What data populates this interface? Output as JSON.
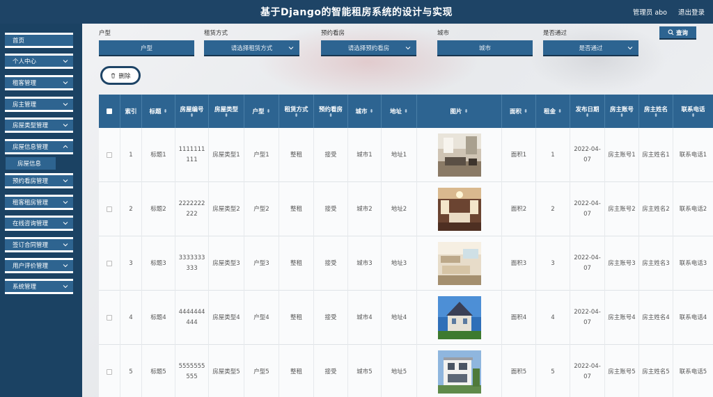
{
  "header": {
    "title": "基于Django的智能租房系统的设计与实现",
    "user": "管理员 abo",
    "logout": "退出登录"
  },
  "sidebar": {
    "items": [
      {
        "label": "首页",
        "has_chevron": false
      },
      {
        "label": "个人中心",
        "has_chevron": true
      },
      {
        "label": "租客管理",
        "has_chevron": true
      },
      {
        "label": "房主管理",
        "has_chevron": true
      },
      {
        "label": "房屋类型管理",
        "has_chevron": true
      },
      {
        "label": "房屋信息管理",
        "has_chevron": true
      },
      {
        "label": "预约看房管理",
        "has_chevron": true
      },
      {
        "label": "租客租房管理",
        "has_chevron": true
      },
      {
        "label": "在线咨询管理",
        "has_chevron": true
      },
      {
        "label": "签订合同管理",
        "has_chevron": true
      },
      {
        "label": "用户评价管理",
        "has_chevron": true
      },
      {
        "label": "系统管理",
        "has_chevron": true
      }
    ],
    "subitem": "房屋信息"
  },
  "filters": {
    "house_type": {
      "label": "户型",
      "value": "户型"
    },
    "rent_method": {
      "label": "租赁方式",
      "value": "请选择租赁方式"
    },
    "viewing": {
      "label": "预约看房",
      "value": "请选择预约看房"
    },
    "city": {
      "label": "城市",
      "value": "城市"
    },
    "approved": {
      "label": "是否通过",
      "value": "是否通过"
    },
    "search_label": "查询"
  },
  "actions": {
    "delete_label": "删除"
  },
  "table": {
    "columns": [
      "索引",
      "标题",
      "房屋编号",
      "房屋类型",
      "户型",
      "租赁方式",
      "预约看房",
      "城市",
      "地址",
      "图片",
      "面积",
      "租金",
      "发布日期",
      "房主账号",
      "房主姓名",
      "联系电话"
    ],
    "rows": [
      {
        "index": "1",
        "title": "标题1",
        "number": "1111111111",
        "type": "房屋类型1",
        "layout": "户型1",
        "rent": "整租",
        "viewing": "接受",
        "city": "城市1",
        "address": "地址1",
        "image": "living-room",
        "area": "面积1",
        "price": "1",
        "date": "2022-04-07",
        "account": "房主账号1",
        "owner": "房主姓名1",
        "phone": "联系电话1"
      },
      {
        "index": "2",
        "title": "标题2",
        "number": "2222222222",
        "type": "房屋类型2",
        "layout": "户型2",
        "rent": "整租",
        "viewing": "接受",
        "city": "城市2",
        "address": "地址2",
        "image": "bedroom",
        "area": "面积2",
        "price": "2",
        "date": "2022-04-07",
        "account": "房主账号2",
        "owner": "房主姓名2",
        "phone": "联系电话2"
      },
      {
        "index": "3",
        "title": "标题3",
        "number": "3333333333",
        "type": "房屋类型3",
        "layout": "户型3",
        "rent": "整租",
        "viewing": "接受",
        "city": "城市3",
        "address": "地址3",
        "image": "lounge",
        "area": "面积3",
        "price": "3",
        "date": "2022-04-07",
        "account": "房主账号3",
        "owner": "房主姓名3",
        "phone": "联系电话3"
      },
      {
        "index": "4",
        "title": "标题4",
        "number": "4444444444",
        "type": "房屋类型4",
        "layout": "户型4",
        "rent": "整租",
        "viewing": "接受",
        "city": "城市4",
        "address": "地址4",
        "image": "villa",
        "area": "面积4",
        "price": "4",
        "date": "2022-04-07",
        "account": "房主账号4",
        "owner": "房主姓名4",
        "phone": "联系电话4"
      },
      {
        "index": "5",
        "title": "标题5",
        "number": "5555555555",
        "type": "房屋类型5",
        "layout": "户型5",
        "rent": "整租",
        "viewing": "接受",
        "city": "城市5",
        "address": "地址5",
        "image": "modern-house",
        "area": "面积5",
        "price": "5",
        "date": "2022-04-07",
        "account": "房主账号5",
        "owner": "房主姓名5",
        "phone": "联系电话5"
      }
    ]
  },
  "colors": {
    "header_bg": "#1e4466",
    "sidebar_bg": "#1b4263",
    "accent": "#2d6491"
  }
}
